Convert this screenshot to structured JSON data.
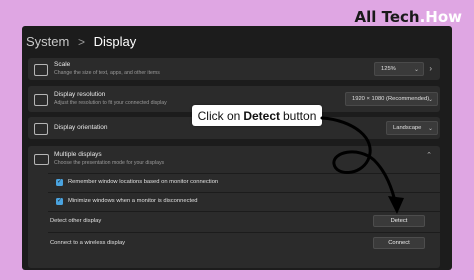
{
  "brand": {
    "text": "All Tech",
    "accent": ".How"
  },
  "breadcrumb": {
    "parent": "System",
    "separator": ">",
    "current": "Display"
  },
  "scale": {
    "title": "Scale",
    "subtitle": "Change the size of text, apps, and other items",
    "value": "125%"
  },
  "resolution": {
    "title": "Display resolution",
    "subtitle": "Adjust the resolution to fit your connected display",
    "value": "1920 × 1080 (Recommended)"
  },
  "orientation": {
    "title": "Display orientation",
    "value": "Landscape"
  },
  "multiple_displays": {
    "title": "Multiple displays",
    "subtitle": "Choose the presentation mode for your displays",
    "remember_label": "Remember window locations based on monitor connection",
    "minimize_label": "Minimize windows when a monitor is disconnected",
    "detect_label": "Detect other display",
    "detect_button": "Detect",
    "wireless_label": "Connect to a wireless display",
    "connect_button": "Connect"
  },
  "callout": {
    "prefix": "Click on",
    "bold": "Detect",
    "suffix": "button"
  },
  "colors": {
    "background": "#dfa6e3",
    "window": "#1c1c1c",
    "card": "#2b2b2b",
    "accent": "#4aa3df"
  }
}
